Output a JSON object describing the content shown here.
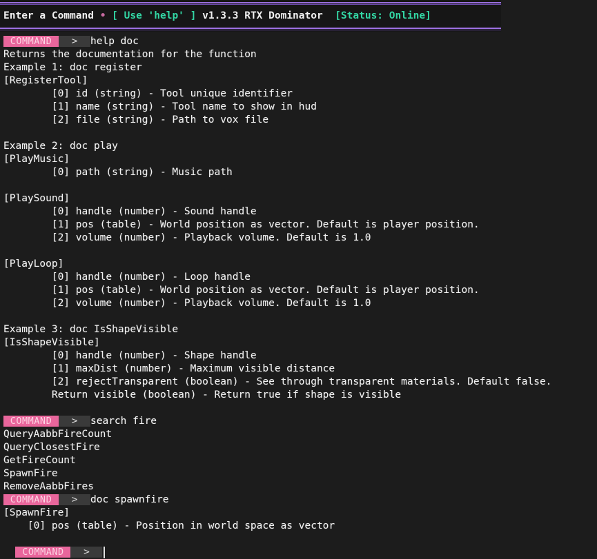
{
  "header": {
    "title": "Enter a Command",
    "separator": "•",
    "help_hint": "[ Use 'help' ]",
    "version": "v1.3.3 RTX Dominator",
    "status": "[Status: Online]"
  },
  "prompt": {
    "badge": "COMMAND",
    "arrow": ">"
  },
  "history": [
    {
      "command": "help doc",
      "output": [
        "Returns the documentation for the function",
        "Example 1: doc register",
        "[RegisterTool]",
        "        [0] id (string) - Tool unique identifier",
        "        [1] name (string) - Tool name to show in hud",
        "        [2] file (string) - Path to vox file",
        "",
        "Example 2: doc play",
        "[PlayMusic]",
        "        [0] path (string) - Music path",
        "",
        "[PlaySound]",
        "        [0] handle (number) - Sound handle",
        "        [1] pos (table) - World position as vector. Default is player position.",
        "        [2] volume (number) - Playback volume. Default is 1.0",
        "",
        "[PlayLoop]",
        "        [0] handle (number) - Loop handle",
        "        [1] pos (table) - World position as vector. Default is player position.",
        "        [2] volume (number) - Playback volume. Default is 1.0",
        "",
        "Example 3: doc IsShapeVisible",
        "[IsShapeVisible]",
        "        [0] handle (number) - Shape handle",
        "        [1] maxDist (number) - Maximum visible distance",
        "        [2] rejectTransparent (boolean) - See through transparent materials. Default false.",
        "        Return visible (boolean) - Return true if shape is visible",
        ""
      ]
    },
    {
      "command": "search fire",
      "output": [
        "QueryAabbFireCount",
        "QueryClosestFire",
        "GetFireCount",
        "SpawnFire",
        "RemoveAabbFires"
      ]
    },
    {
      "command": "doc spawnfire",
      "output": [
        "[SpawnFire]",
        "    [0] pos (table) - Position in world space as vector"
      ]
    }
  ],
  "input": {
    "value": ""
  },
  "colors": {
    "accent_purple": "#9b6fe0",
    "badge_pink": "#e9669c",
    "status_green": "#33d6a4",
    "background": "#1c1c1c"
  }
}
